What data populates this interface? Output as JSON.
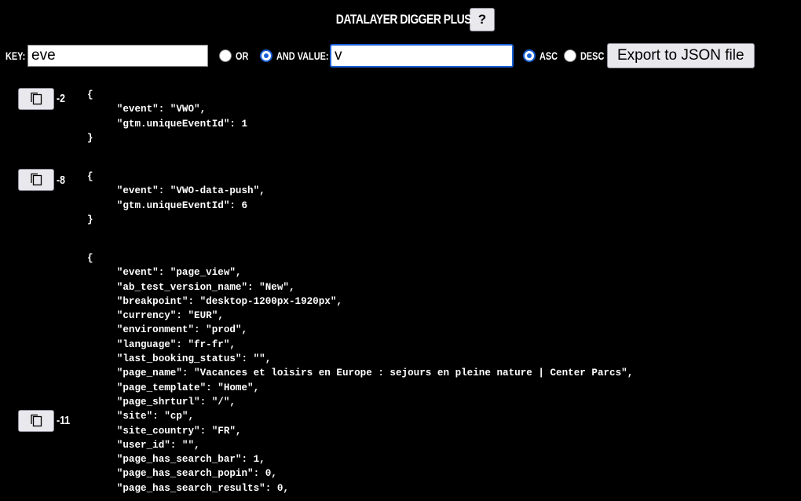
{
  "header": {
    "title": "DATALAYER DIGGER PLUS",
    "help_label": "?"
  },
  "filters": {
    "key_label": "KEY:",
    "key_value": "eve",
    "or_label": "OR",
    "and_value_label": "AND VALUE:",
    "value_value": "v",
    "asc_label": "ASC",
    "desc_label": "DESC",
    "export_label": "Export to JSON file",
    "logic_selected": "AND",
    "sort_selected": "ASC"
  },
  "entries": [
    {
      "index": "-2",
      "json": "{\n     \"event\": \"VWO\",\n     \"gtm.uniqueEventId\": 1\n}"
    },
    {
      "index": "-8",
      "json": "{\n     \"event\": \"VWO-data-push\",\n     \"gtm.uniqueEventId\": 6\n}"
    },
    {
      "index": "-11",
      "json": "{\n     \"event\": \"page_view\",\n     \"ab_test_version_name\": \"New\",\n     \"breakpoint\": \"desktop-1200px-1920px\",\n     \"currency\": \"EUR\",\n     \"environment\": \"prod\",\n     \"language\": \"fr-fr\",\n     \"last_booking_status\": \"\",\n     \"page_name\": \"Vacances et loisirs en Europe : sejours en pleine nature | Center Parcs\",\n     \"page_template\": \"Home\",\n     \"page_shrturl\": \"/\",\n     \"site\": \"cp\",\n     \"site_country\": \"FR\",\n     \"user_id\": \"\",\n     \"page_has_search_bar\": 1,\n     \"page_has_search_popin\": 0,\n     \"page_has_search_results\": 0,"
    }
  ]
}
